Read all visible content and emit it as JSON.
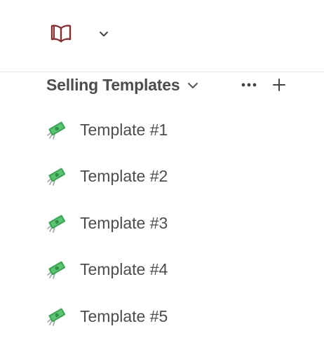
{
  "workspace": {
    "icon": "open-book-icon",
    "accent": "#8b2c2c",
    "dropdown_icon": "chevron-down-icon"
  },
  "section": {
    "title": "Selling Templates",
    "chevron_icon": "chevron-down-icon",
    "more_icon": "ellipsis-icon",
    "add_icon": "plus-icon"
  },
  "items": [
    {
      "label": "Template #1",
      "icon": "money-with-wings-icon"
    },
    {
      "label": "Template #2",
      "icon": "money-with-wings-icon"
    },
    {
      "label": "Template #3",
      "icon": "money-with-wings-icon"
    },
    {
      "label": "Template #4",
      "icon": "money-with-wings-icon"
    },
    {
      "label": "Template #5",
      "icon": "money-with-wings-icon"
    }
  ]
}
